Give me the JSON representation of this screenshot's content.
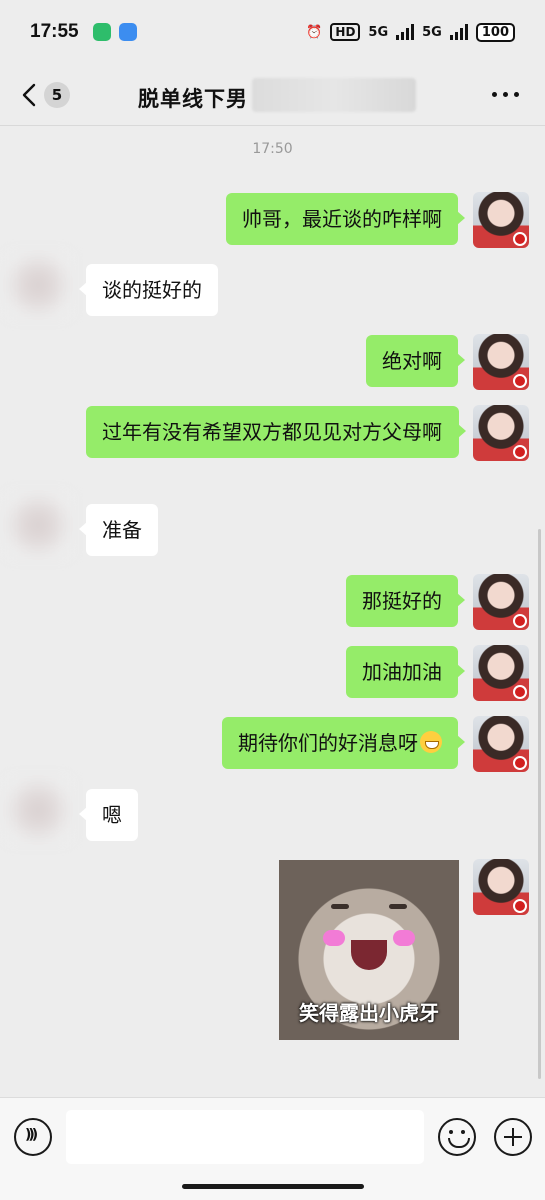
{
  "status_bar": {
    "time": "17:55",
    "hd_label": "HD",
    "network_1": "5G",
    "network_2": "5G",
    "battery": "100"
  },
  "header": {
    "back_count": "5",
    "title": "脱单线下男"
  },
  "chat": {
    "timestamp": "17:50",
    "messages": [
      {
        "sender": "me",
        "text": "帅哥，最近谈的咋样啊"
      },
      {
        "sender": "other",
        "text": "谈的挺好的"
      },
      {
        "sender": "me",
        "text": "绝对啊"
      },
      {
        "sender": "me",
        "text": "过年有没有希望双方都见见对方父母啊"
      },
      {
        "sender": "other",
        "text": "准备"
      },
      {
        "sender": "me",
        "text": "那挺好的"
      },
      {
        "sender": "me",
        "text": "加油加油"
      },
      {
        "sender": "me",
        "text": "期待你们的好消息呀",
        "emoji": "grinning-emoji"
      },
      {
        "sender": "other",
        "text": "嗯"
      },
      {
        "sender": "me",
        "type": "sticker",
        "caption": "笑得露出小虎牙"
      }
    ]
  },
  "input_bar": {
    "placeholder": "",
    "icons": [
      "voice-icon",
      "emoji-icon",
      "plus-icon"
    ]
  },
  "colors": {
    "my_bubble": "#95ec69",
    "other_bubble": "#ffffff",
    "background": "#ededed"
  }
}
